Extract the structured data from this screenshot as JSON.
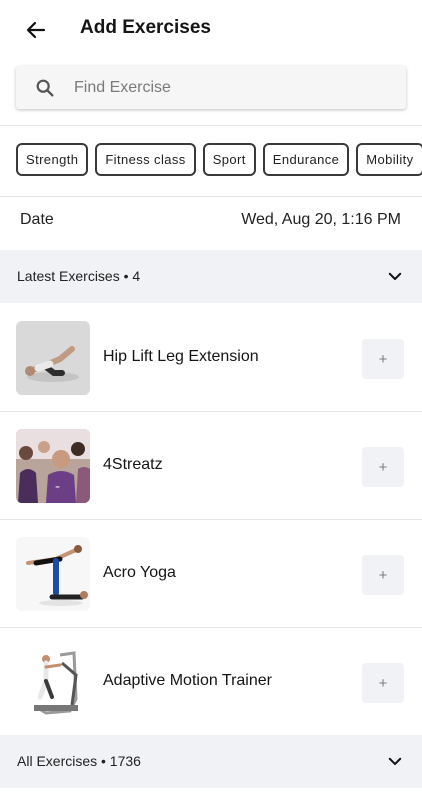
{
  "header": {
    "title": "Add Exercises"
  },
  "search": {
    "placeholder": "Find Exercise",
    "value": ""
  },
  "chips": [
    "Strength",
    "Fitness class",
    "Sport",
    "Endurance",
    "Mobility"
  ],
  "date": {
    "label": "Date",
    "value": "Wed, Aug 20, 1:16 PM"
  },
  "latest": {
    "label": "Latest Exercises • 4"
  },
  "exercises": [
    {
      "name": "Hip Lift Leg Extension",
      "add": "+"
    },
    {
      "name": "4Streatz",
      "add": "+"
    },
    {
      "name": "Acro Yoga",
      "add": "+"
    },
    {
      "name": "Adaptive Motion Trainer",
      "add": "+"
    }
  ],
  "all": {
    "label": "All Exercises • 1736"
  },
  "colors": {
    "section_bg": "#f1f2f6",
    "chip_border": "#3a3a3a",
    "text": "#151515"
  }
}
